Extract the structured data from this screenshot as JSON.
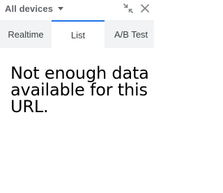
{
  "header": {
    "device_filter": "All devices",
    "icons": [
      "caret-down-icon",
      "collapse-icon",
      "close-icon"
    ]
  },
  "tabs": [
    {
      "label": "Realtime",
      "active": false
    },
    {
      "label": "List",
      "active": true
    },
    {
      "label": "A/B Test",
      "active": false
    }
  ],
  "main": {
    "message": "Not enough data available for this URL."
  },
  "colors": {
    "accent": "#1a73e8",
    "tabbar_bg": "#f1f3f4",
    "muted_text": "#5f6368"
  }
}
